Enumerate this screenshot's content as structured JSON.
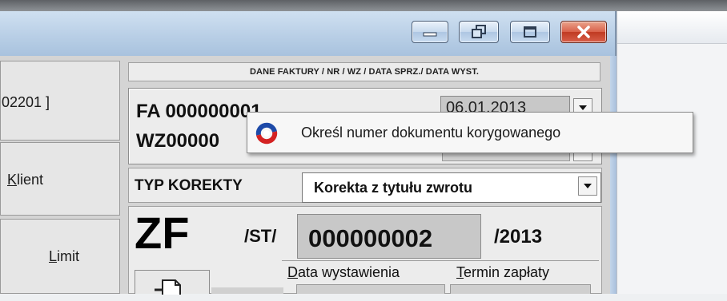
{
  "left_panel": {
    "code_text": "02201 ]",
    "client_button": "Klient",
    "limit_button": "Limit"
  },
  "invoice": {
    "header": "DANE FAKTURY / NR / WZ / DATA SPRZ./ DATA WYST.",
    "fa_number": "FA 000000001",
    "wz_number": "WZ00000",
    "date_value": "06.01.2013"
  },
  "correction": {
    "type_label": "TYP KOREKTY",
    "type_value": "Korekta z tytułu zwrotu",
    "prefix": "ZF",
    "series": "/ST/",
    "number": "000000002",
    "year": "/2013",
    "issue_date_label": "Data wystawienia",
    "payment_term_label": "Termin zapłaty"
  },
  "tooltip": {
    "text": "Określ numer dokumentu korygowanego",
    "icon": "app-logo-icon"
  },
  "window_controls": {
    "icons": [
      "minimize-icon",
      "restore-icon",
      "maximize-icon",
      "close-icon"
    ]
  }
}
